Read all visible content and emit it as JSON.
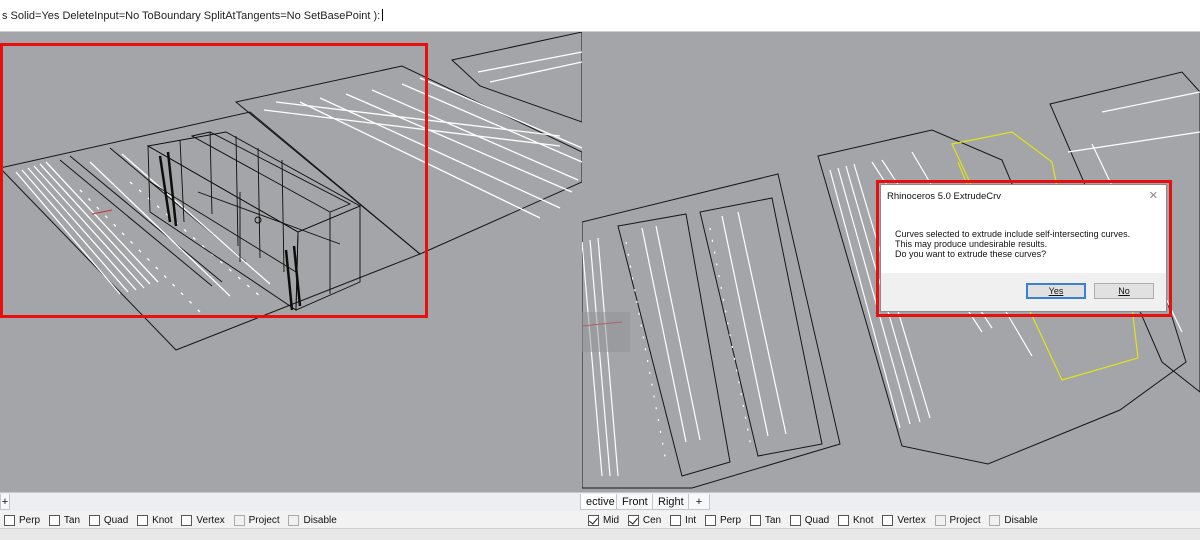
{
  "command_line": {
    "prompt": "s Solid=Yes DeleteInput=No ToBoundary SplitAtTangents=No SetBasePoint ):"
  },
  "viewport_tabs": [
    "ective",
    "Front",
    "Right",
    "+"
  ],
  "osnap_left": {
    "items": [
      {
        "label": "Perp",
        "checked": false,
        "disabled": false
      },
      {
        "label": "Tan",
        "checked": false,
        "disabled": false
      },
      {
        "label": "Quad",
        "checked": false,
        "disabled": false
      },
      {
        "label": "Knot",
        "checked": false,
        "disabled": false
      },
      {
        "label": "Vertex",
        "checked": false,
        "disabled": false
      },
      {
        "label": "Project",
        "checked": false,
        "disabled": true
      },
      {
        "label": "Disable",
        "checked": false,
        "disabled": true
      }
    ]
  },
  "osnap_right": {
    "items": [
      {
        "label": "Mid",
        "checked": true,
        "disabled": false
      },
      {
        "label": "Cen",
        "checked": true,
        "disabled": false
      },
      {
        "label": "Int",
        "checked": false,
        "disabled": false
      },
      {
        "label": "Perp",
        "checked": false,
        "disabled": false
      },
      {
        "label": "Tan",
        "checked": false,
        "disabled": false
      },
      {
        "label": "Quad",
        "checked": false,
        "disabled": false
      },
      {
        "label": "Knot",
        "checked": false,
        "disabled": false
      },
      {
        "label": "Vertex",
        "checked": false,
        "disabled": false
      },
      {
        "label": "Project",
        "checked": false,
        "disabled": true
      },
      {
        "label": "Disable",
        "checked": false,
        "disabled": true
      }
    ]
  },
  "dialog": {
    "title": "Rhinoceros 5.0  ExtrudeCrv",
    "close": "✕",
    "message_lines": [
      "Curves selected to extrude include self-intersecting curves.",
      "This may produce undesirable results.",
      "Do you want to extrude these curves?"
    ],
    "yes_label": "Yes",
    "no_label": "No"
  },
  "colors": {
    "viewport_bg": "#a3a5a8",
    "highlight": "#e8100f",
    "selected_curve": "#e3e31a",
    "button_focus": "#3c7fd6"
  }
}
